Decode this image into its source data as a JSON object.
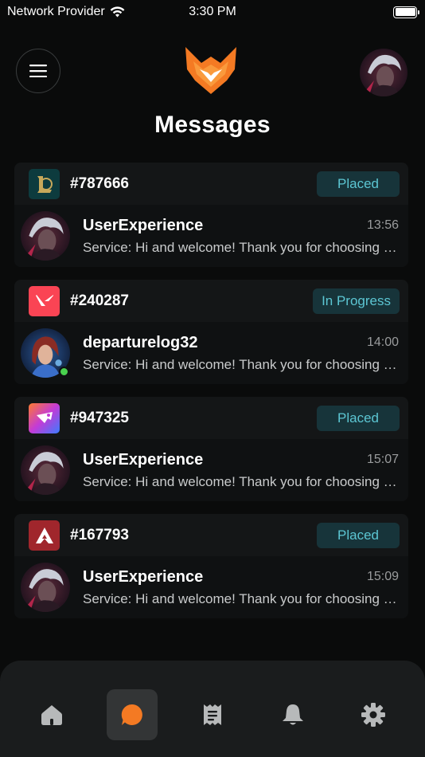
{
  "status_bar": {
    "carrier": "Network Provider",
    "time": "3:30 PM"
  },
  "header": {
    "title": "Messages"
  },
  "colors": {
    "accent": "#f47a23",
    "badge_bg": "#17343a",
    "badge_text": "#5cc6d3",
    "online": "#49d14e"
  },
  "orders": [
    {
      "game_icon": "league-of-legends-icon",
      "order_id": "#787666",
      "status": "Placed",
      "user": "UserExperience",
      "time": "13:56",
      "message": "Service: Hi and welcome! Thank you for choosing our service.",
      "online": false
    },
    {
      "game_icon": "valorant-icon",
      "order_id": "#240287",
      "status": "In Progress",
      "user": "departurelog32",
      "time": "14:00",
      "message": "Service: Hi and welcome! Thank you for choosing our service.",
      "online": true
    },
    {
      "game_icon": "rocket-league-icon",
      "order_id": "#947325",
      "status": "Placed",
      "user": "UserExperience",
      "time": "15:07",
      "message": "Service: Hi and welcome! Thank you for choosing our service.",
      "online": false
    },
    {
      "game_icon": "apex-legends-icon",
      "order_id": "#167793",
      "status": "Placed",
      "user": "UserExperience",
      "time": "15:09",
      "message": "Service: Hi and welcome! Thank you for choosing our service.",
      "online": false
    }
  ],
  "bottom_nav": [
    {
      "icon": "home-icon",
      "active": false
    },
    {
      "icon": "chat-icon",
      "active": true
    },
    {
      "icon": "orders-icon",
      "active": false
    },
    {
      "icon": "bell-icon",
      "active": false
    },
    {
      "icon": "gear-icon",
      "active": false
    }
  ]
}
